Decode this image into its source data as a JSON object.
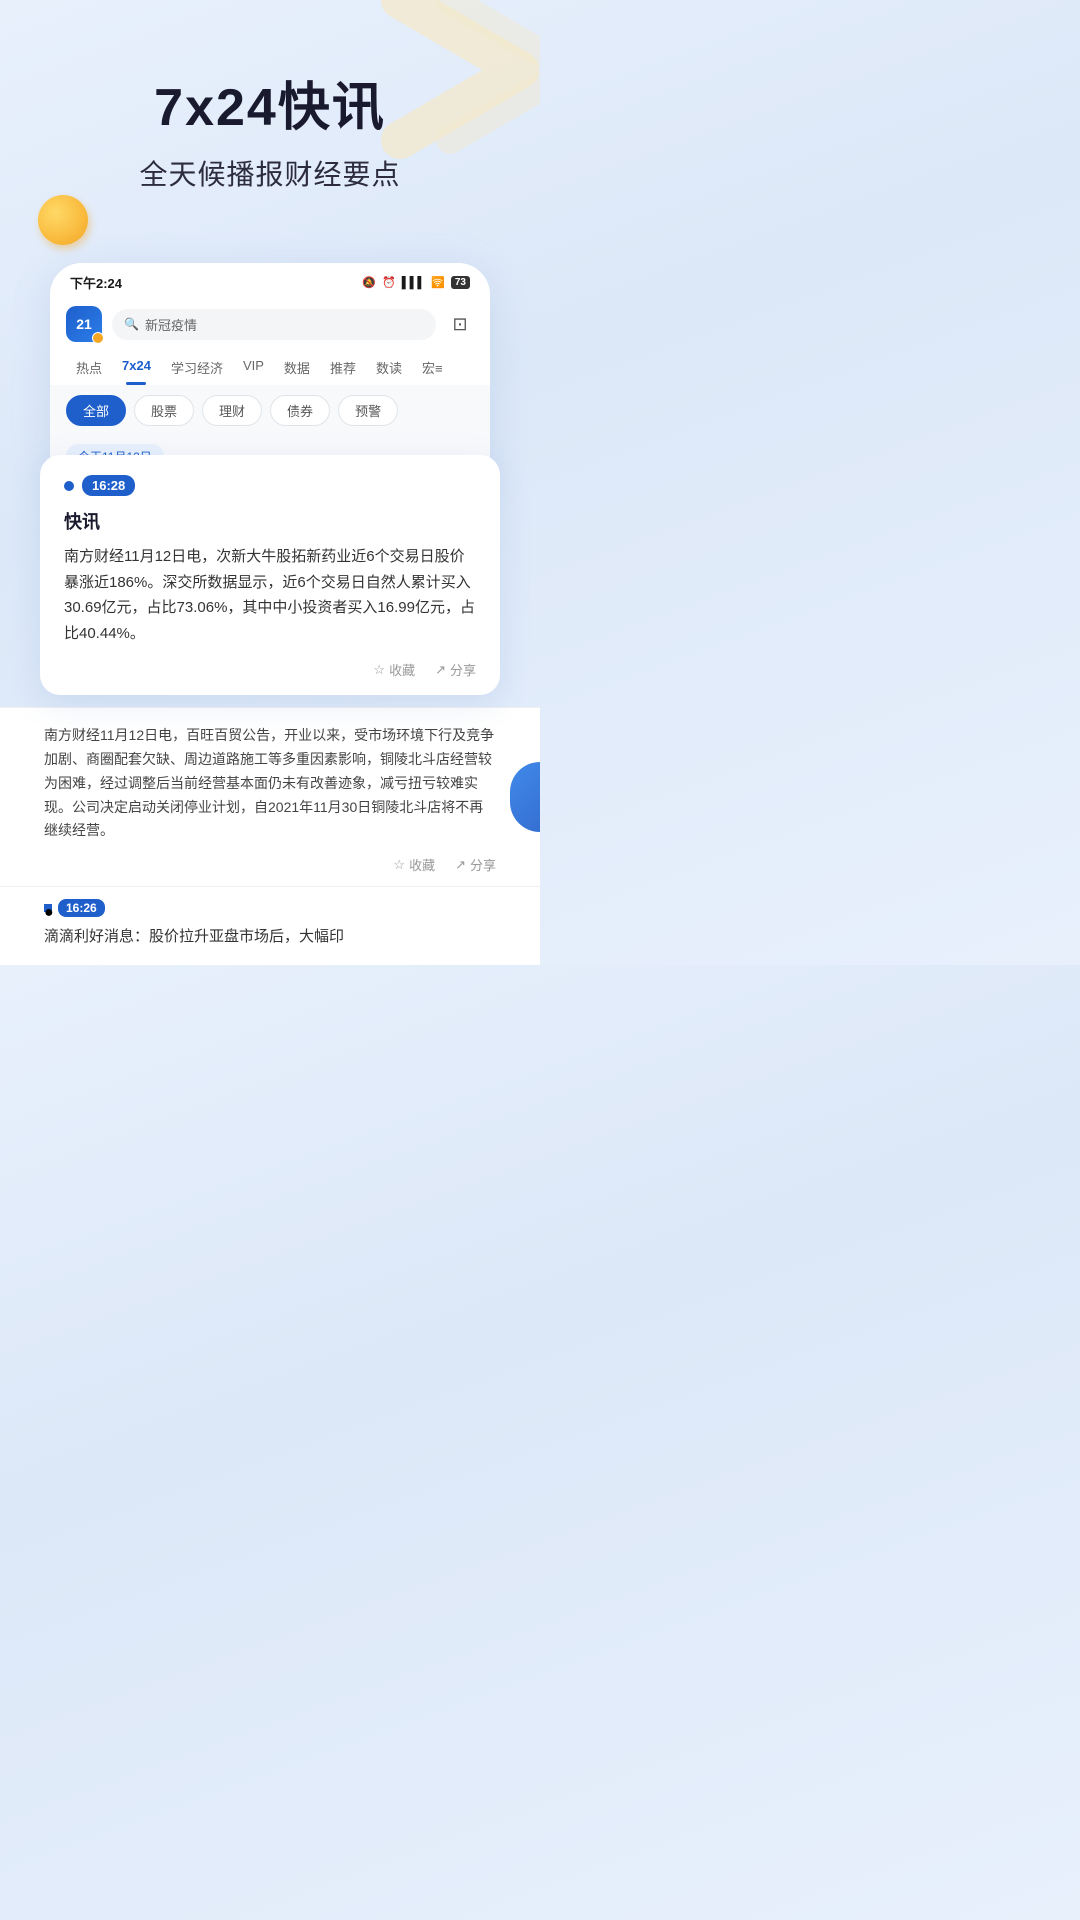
{
  "hero": {
    "title": "7x24快讯",
    "subtitle": "全天候播报财经要点"
  },
  "statusBar": {
    "time": "下午2:24",
    "batteryLevel": "73",
    "icons": [
      "🔕",
      "⏰",
      "📶",
      "🛜"
    ]
  },
  "appHeader": {
    "logoText": "21",
    "searchPlaceholder": "新冠疫情"
  },
  "navTabs": [
    {
      "label": "热点",
      "active": false
    },
    {
      "label": "7x24",
      "active": true
    },
    {
      "label": "学习经济",
      "active": false
    },
    {
      "label": "VIP",
      "active": false
    },
    {
      "label": "数据",
      "active": false
    },
    {
      "label": "推荐",
      "active": false
    },
    {
      "label": "数读",
      "active": false
    },
    {
      "label": "宏≡",
      "active": false
    }
  ],
  "filterChips": [
    {
      "label": "全部",
      "active": true
    },
    {
      "label": "股票",
      "active": false
    },
    {
      "label": "理财",
      "active": false
    },
    {
      "label": "债券",
      "active": false
    },
    {
      "label": "预警",
      "active": false
    }
  ],
  "dateLabel": "今天11月12日",
  "newsCard": {
    "time": "16:28",
    "tag": "快讯",
    "content": "南方财经11月12日电，次新大牛股拓新药业近6个交易日股价暴涨近186%。深交所数据显示，近6个交易日自然人累计买入30.69亿元，占比73.06%，其中中小投资者买入16.99亿元，占比40.44%。",
    "collectLabel": "☆收藏",
    "shareLabel": "↗分享"
  },
  "secondArticle": {
    "content": "南方财经11月12日电，百旺百贸公告，开业以来，受市场环境下行及竞争加剧、商圈配套欠缺、周边道路施工等多重因素影响，铜陵北斗店经营较为困难，经过调整后当前经营基本面仍未有改善迹象，减亏扭亏较难实现。公司决定启动关闭停业计划，自2021年11月30日铜陵北斗店将不再继续经营。",
    "collectLabel": "☆收藏",
    "shareLabel": "↗分享"
  },
  "thirdArticle": {
    "time": "16:26",
    "title": "滴滴利好消息：股价拉升亚盘市场后，大幅印"
  }
}
